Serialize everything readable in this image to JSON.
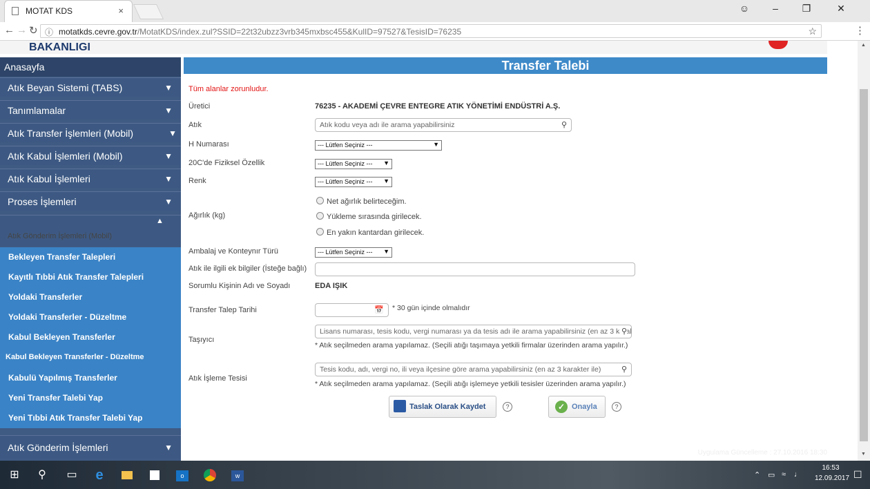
{
  "browser": {
    "tab_title": "MOTAT KDS",
    "tab_close": "×",
    "url_host": "motatkds.cevre.gov.tr",
    "url_path": "/MotatKDS/index.zul?SSID=22t32ubzz3vrb345mxbsc455&KulID=97527&TesisID=76235"
  },
  "page": {
    "logo_text": "BAKANLIGI",
    "footer_faint": "Uygulama Güncelleme : 27.10.2016 18:30"
  },
  "sidebar": {
    "home": "Anasayfa",
    "menus": [
      {
        "label": "Atık Beyan Sistemi (TABS)"
      },
      {
        "label": "Tanımlamalar"
      },
      {
        "label": "Atık Transfer İşlemleri (Mobil)"
      },
      {
        "label": "Atık Kabul İşlemleri (Mobil)"
      },
      {
        "label": "Atık Kabul İşlemleri"
      },
      {
        "label": "Proses İşlemleri"
      }
    ],
    "open_menu": "Atık Gönderim İşlemleri (Mobil)",
    "submenu": [
      "Bekleyen Transfer Talepleri",
      "Kayıtlı Tıbbi Atık Transfer Talepleri",
      "Yoldaki Transferler",
      "Yoldaki Transferler - Düzeltme",
      "Kabul Bekleyen Transferler",
      "Kabul Bekleyen Transferler - Düzeltme",
      "Kabulü Yapılmış Transferler",
      "Yeni Transfer Talebi Yap",
      "Yeni Tıbbi Atık Transfer Talebi Yap"
    ],
    "last_menu": "Atık Gönderim İşlemleri"
  },
  "form": {
    "title": "Transfer Talebi",
    "required_note": "Tüm alanlar zorunludur.",
    "uretici_label": "Üretici",
    "uretici_value": "76235 - AKADEMİ ÇEVRE ENTEGRE ATIK YÖNETİMİ ENDÜSTRİ A.Ş.",
    "atik_label": "Atık",
    "atik_placeholder": "Atık kodu veya adı ile arama yapabilirsiniz",
    "h_label": "H Numarası",
    "select_placeholder": "--- Lütfen Seçiniz ---",
    "fiziksel_label": "20C'de Fiziksel Özellik",
    "renk_label": "Renk",
    "agirlik_label": "Ağırlık (kg)",
    "agirlik_options": [
      "Net ağırlık belirteceğim.",
      "Yükleme sırasında girilecek.",
      "En yakın kantardan girilecek."
    ],
    "ambalaj_label": "Ambalaj ve Konteynır Türü",
    "ek_bilgi_label": "Atık ile ilgili ek bilgiler (İsteğe bağlı)",
    "sorumlu_label": "Sorumlu Kişinin Adı ve Soyadı",
    "sorumlu_value": "EDA IŞIK",
    "tarih_label": "Transfer Talep Tarihi",
    "tarih_note": "* 30 gün içinde olmalıdır",
    "tasiyici_label": "Taşıyıcı",
    "tasiyici_placeholder": "Lisans numarası, tesis kodu, vergi numarası ya da tesis adı ile arama yapabilirsiniz (en az 3 karakter ile)",
    "tasiyici_note": "* Atık seçilmeden arama yapılamaz. (Seçili atığı taşımaya yetkili firmalar üzerinden arama yapılır.)",
    "isleme_label": "Atık İşleme Tesisi",
    "isleme_placeholder": "Tesis kodu, adı, vergi no, ili veya ilçesine göre arama yapabilirsiniz (en az 3 karakter ile)",
    "isleme_note": "* Atık seçilmeden arama yapılamaz. (Seçili atığı işlemeye yetkili tesisler üzerinden arama yapılır.)",
    "save_label": "Taslak Olarak Kaydet",
    "approve_label": "Onayla",
    "help": "?"
  },
  "taskbar": {
    "time": "16:53",
    "date": "12.09.2017"
  },
  "icons": [
    "page-icon",
    "back-icon",
    "forward-icon",
    "reload-icon",
    "info-icon",
    "star-icon",
    "menu-icon",
    "search-icon",
    "calendar-icon",
    "save-icon",
    "check-icon",
    "help-icon",
    "windows-icon",
    "cortana-icon",
    "task-view-icon",
    "edge-icon",
    "explorer-icon",
    "store-icon",
    "outlook-icon",
    "chrome-icon",
    "word-icon"
  ]
}
